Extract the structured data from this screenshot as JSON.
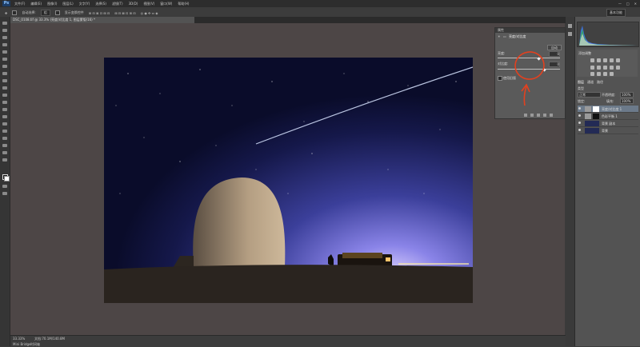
{
  "menubar": {
    "app_badge": "Ps",
    "menus": [
      "文件(F)",
      "编辑(E)",
      "图像(I)",
      "图层(L)",
      "文字(Y)",
      "选择(S)",
      "滤镜(T)",
      "3D(D)",
      "视图(V)",
      "窗口(W)",
      "帮助(H)"
    ],
    "window_controls": [
      "—",
      "□",
      "✕"
    ]
  },
  "optbar": {
    "auto_select_label": "自动选择:",
    "auto_select_value": "组",
    "show_transform_label": "显示变换控件",
    "workspace": "基本功能"
  },
  "document": {
    "tab_title": "DSC_0108.tif @ 33.3% (亮度/对比度 1, 图层蒙版/16) *",
    "zoom": "33.33%",
    "doc_info": "文档:70.1M/140.8M"
  },
  "properties": {
    "panel_title": "属性",
    "adjustment_title": "亮度/对比度",
    "auto_button": "自动",
    "brightness_label": "亮度:",
    "brightness_value": "0",
    "contrast_label": "对比度:",
    "contrast_value": "0",
    "legacy_label": "使用旧版"
  },
  "adjustments": {
    "title": "添加调整"
  },
  "layers": {
    "tabs": [
      "图层",
      "通道",
      "路径"
    ],
    "kind_label": "类型",
    "blend_mode": "正常",
    "opacity_label": "不透明度:",
    "opacity_value": "100%",
    "lock_label": "锁定:",
    "fill_label": "填充:",
    "fill_value": "100%",
    "rows": [
      {
        "name": "亮度/对比度 1"
      },
      {
        "name": "色彩平衡 1"
      },
      {
        "name": "背景 副本"
      },
      {
        "name": "背景"
      }
    ]
  },
  "annotation": {
    "color": "#e2411f"
  }
}
